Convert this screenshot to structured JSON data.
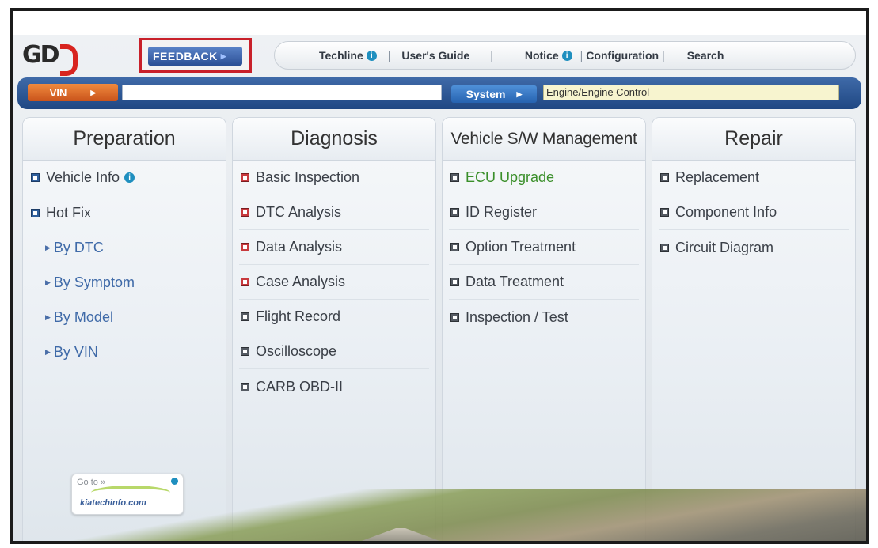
{
  "header": {
    "logo_text": "GD",
    "feedback_label": "FEEDBACK",
    "nav": [
      {
        "label": "Techline",
        "info": true
      },
      {
        "label": "User's Guide",
        "info": false
      },
      {
        "label": "Notice",
        "info": true
      },
      {
        "label": "Configuration",
        "info": false
      },
      {
        "label": "Search",
        "info": false
      }
    ]
  },
  "vinbar": {
    "vin_label": "VIN",
    "vin_value": "",
    "system_label": "System",
    "system_value": "Engine/Engine Control"
  },
  "columns": {
    "preparation": {
      "title": "Preparation",
      "items": [
        "Vehicle Info",
        "Hot Fix",
        "By DTC",
        "By Symptom",
        "By Model",
        "By VIN"
      ]
    },
    "diagnosis": {
      "title": "Diagnosis",
      "items": [
        "Basic Inspection",
        "DTC Analysis",
        "Data Analysis",
        "Case Analysis",
        "Flight Record",
        "Oscilloscope",
        "CARB OBD-II"
      ]
    },
    "management": {
      "title": "Vehicle S/W Management",
      "items": [
        "ECU Upgrade",
        "ID Register",
        "Option Treatment",
        "Data Treatment",
        "Inspection / Test"
      ]
    },
    "repair": {
      "title": "Repair",
      "items": [
        "Replacement",
        "Component Info",
        "Circuit Diagram"
      ]
    }
  },
  "kia_badge": {
    "goto": "Go to »",
    "url": "kiatechinfo.com"
  },
  "colors": {
    "accent_blue": "#2b4f95",
    "vin_orange": "#e0702d",
    "highlight_red": "#c8202a",
    "ecu_green": "#3a8f2a"
  }
}
